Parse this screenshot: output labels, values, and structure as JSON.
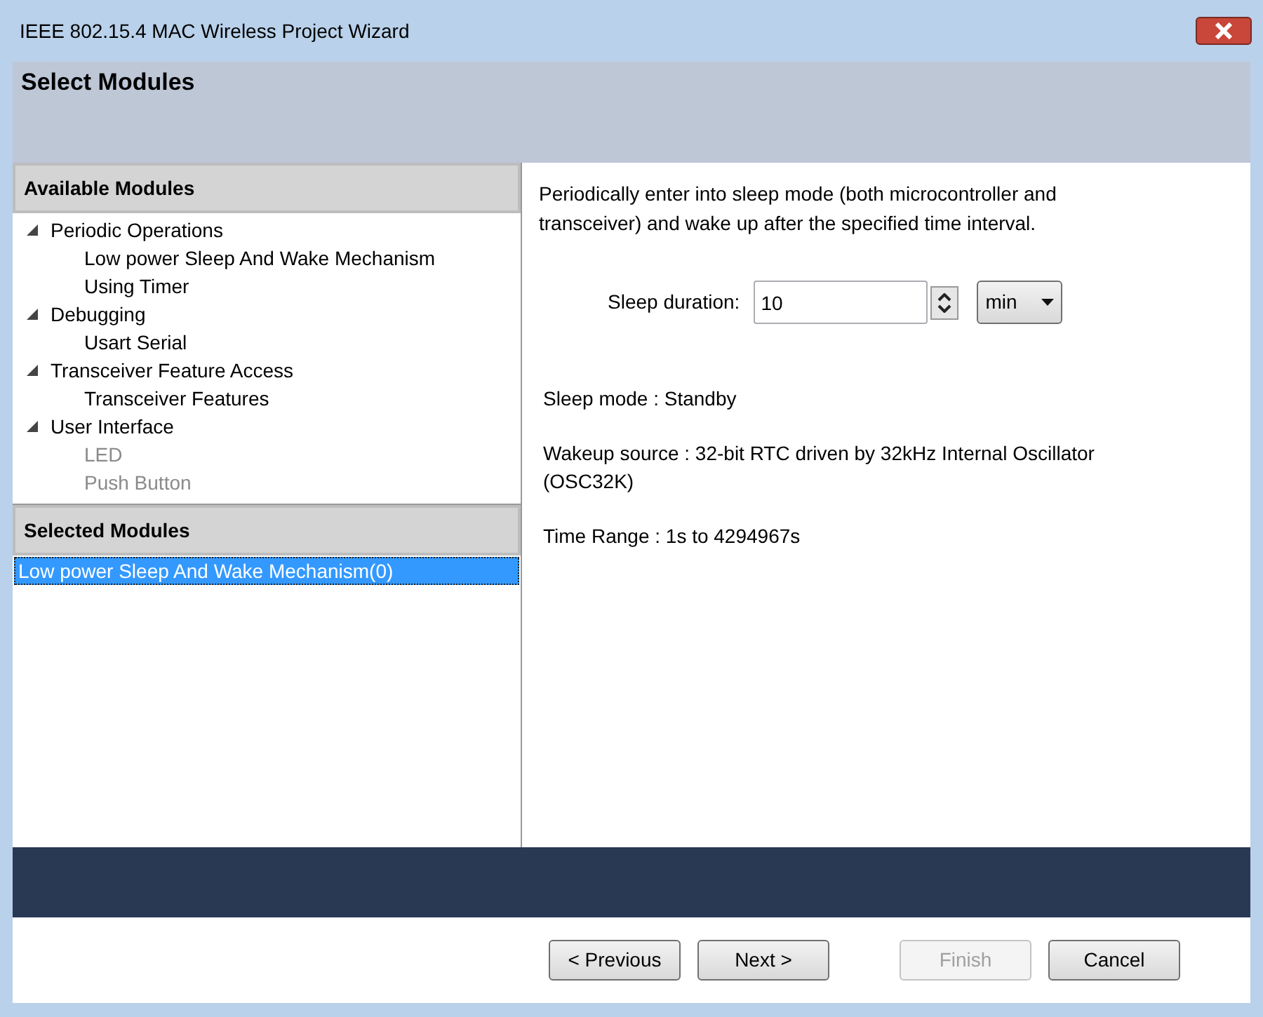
{
  "window": {
    "title": "IEEE 802.15.4 MAC Wireless Project Wizard"
  },
  "header": {
    "title": "Select Modules"
  },
  "available_modules": {
    "heading": "Available Modules",
    "items": [
      {
        "label": "Periodic Operations",
        "expanded": true,
        "children": [
          {
            "label": "Low power Sleep And Wake Mechanism",
            "disabled": false
          },
          {
            "label": "Using Timer",
            "disabled": false
          }
        ]
      },
      {
        "label": "Debugging",
        "expanded": true,
        "children": [
          {
            "label": "Usart Serial",
            "disabled": false
          }
        ]
      },
      {
        "label": "Transceiver Feature Access",
        "expanded": true,
        "children": [
          {
            "label": "Transceiver Features",
            "disabled": false
          }
        ]
      },
      {
        "label": "User Interface",
        "expanded": true,
        "children": [
          {
            "label": "LED",
            "disabled": true
          },
          {
            "label": "Push Button",
            "disabled": true
          }
        ]
      }
    ]
  },
  "selected_modules": {
    "heading": "Selected Modules",
    "items": [
      {
        "label": "Low power Sleep And Wake Mechanism(0)",
        "selected": true
      }
    ]
  },
  "details": {
    "description": "Periodically enter into sleep mode (both microcontroller and transceiver) and wake up after the specified time interval.",
    "sleep_duration": {
      "label": "Sleep duration:",
      "value": "10",
      "unit": "min"
    },
    "info": [
      "Sleep mode : Standby",
      "Wakeup source : 32-bit RTC driven by 32kHz Internal Oscillator (OSC32K)",
      "Time Range : 1s to 4294967s"
    ]
  },
  "buttons": [
    {
      "label": "< Previous",
      "disabled": false
    },
    {
      "label": "Next >",
      "disabled": false
    },
    {
      "label": "Finish",
      "disabled": true
    },
    {
      "label": "Cancel",
      "disabled": false
    }
  ]
}
